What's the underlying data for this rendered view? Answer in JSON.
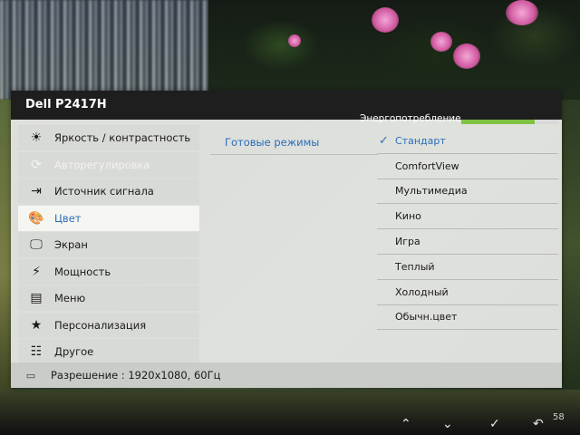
{
  "header": {
    "model": "Dell P2417H",
    "energy_label": "Энергопотребление",
    "energy_level": 0.75
  },
  "menu": {
    "items": [
      {
        "icon": "brightness-icon",
        "glyph": "☀",
        "label": "Яркость / контрастность"
      },
      {
        "icon": "auto-adjust-icon",
        "glyph": "⟳",
        "label": "Авторегулировка"
      },
      {
        "icon": "input-source-icon",
        "glyph": "⇥",
        "label": "Источник сигнала"
      },
      {
        "icon": "color-icon",
        "glyph": "🎨",
        "label": "Цвет"
      },
      {
        "icon": "display-icon",
        "glyph": "🖵",
        "label": "Экран"
      },
      {
        "icon": "power-icon",
        "glyph": "⚡",
        "label": "Мощность"
      },
      {
        "icon": "menu-icon",
        "glyph": "▤",
        "label": "Меню"
      },
      {
        "icon": "star-icon",
        "glyph": "★",
        "label": "Персонализация"
      },
      {
        "icon": "other-icon",
        "glyph": "☷",
        "label": "Другое"
      }
    ]
  },
  "submenu": {
    "title": "Готовые режимы",
    "presets": [
      {
        "label": "Стандарт",
        "selected": true
      },
      {
        "label": "ComfortView"
      },
      {
        "label": "Мультимедиа"
      },
      {
        "label": "Кино"
      },
      {
        "label": "Игра"
      },
      {
        "label": "Теплый"
      },
      {
        "label": "Холодный"
      },
      {
        "label": "Обычн.цвет"
      }
    ]
  },
  "status": {
    "icon": "hdmi-icon",
    "text": "Разрешение : 1920x1080, 60Гц"
  },
  "bezel": {
    "buttons": [
      {
        "icon": "up-icon",
        "glyph": "⌃"
      },
      {
        "icon": "down-icon",
        "glyph": "⌄"
      },
      {
        "icon": "check-icon",
        "glyph": "✓"
      },
      {
        "icon": "back-icon",
        "glyph": "↶"
      }
    ],
    "number": "58"
  }
}
